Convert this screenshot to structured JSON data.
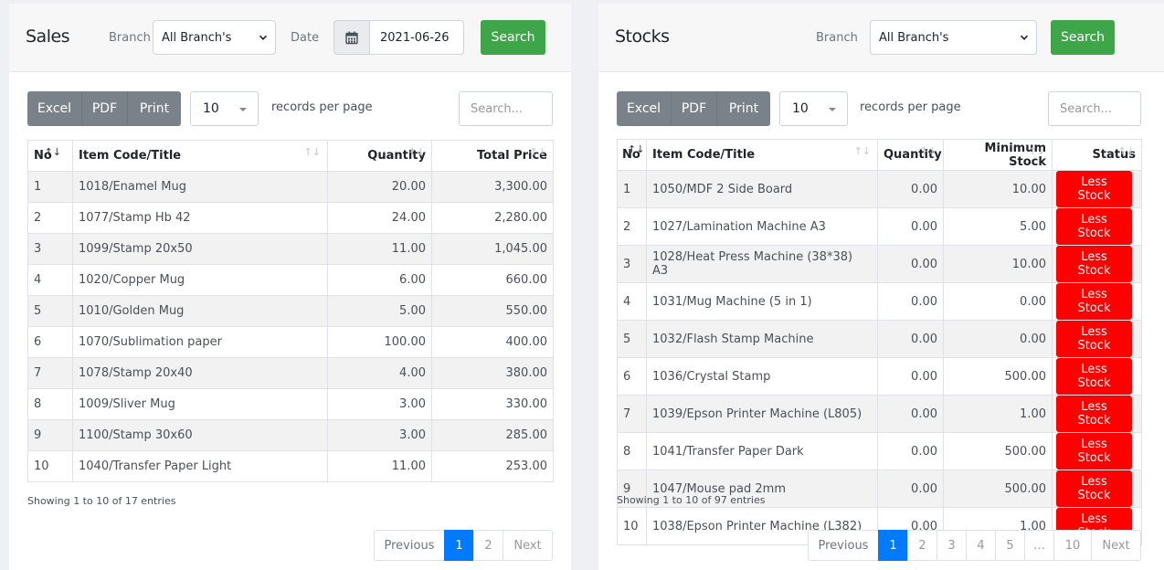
{
  "sales": {
    "title": "Sales",
    "branch_label": "Branch",
    "branch_value": "All Branch's",
    "date_label": "Date",
    "date_value": "2021-06-26",
    "search_button": "Search",
    "export_buttons": [
      "Excel",
      "PDF",
      "Print"
    ],
    "page_length": "10",
    "records_per_page": "records per page",
    "search_placeholder": "Search...",
    "columns": [
      "No",
      "Item Code/Title",
      "Quantity",
      "Total Price"
    ],
    "rows": [
      [
        "1",
        "1018/Enamel Mug",
        "20.00",
        "3,300.00"
      ],
      [
        "2",
        "1077/Stamp Hb 42",
        "24.00",
        "2,280.00"
      ],
      [
        "3",
        "1099/Stamp 20x50",
        "11.00",
        "1,045.00"
      ],
      [
        "4",
        "1020/Copper Mug",
        "6.00",
        "660.00"
      ],
      [
        "5",
        "1010/Golden Mug",
        "5.00",
        "550.00"
      ],
      [
        "6",
        "1070/Sublimation paper",
        "100.00",
        "400.00"
      ],
      [
        "7",
        "1078/Stamp 20x40",
        "4.00",
        "380.00"
      ],
      [
        "8",
        "1009/Sliver Mug",
        "3.00",
        "330.00"
      ],
      [
        "9",
        "1100/Stamp 30x60",
        "3.00",
        "285.00"
      ],
      [
        "10",
        "1040/Transfer Paper Light",
        "11.00",
        "253.00"
      ]
    ],
    "info": "Showing 1 to 10 of 17 entries",
    "pagination": [
      "Previous",
      "1",
      "2",
      "Next"
    ],
    "active_page": "1"
  },
  "stocks": {
    "title": "Stocks",
    "branch_label": "Branch",
    "branch_value": "All Branch's",
    "search_button": "Search",
    "export_buttons": [
      "Excel",
      "PDF",
      "Print"
    ],
    "page_length": "10",
    "records_per_page": "records per page",
    "search_placeholder": "Search...",
    "columns": [
      "No",
      "Item Code/Title",
      "Quantity",
      "Minimum Stock",
      "Status"
    ],
    "rows": [
      [
        "1",
        "1050/MDF 2 Side Board",
        "0.00",
        "10.00",
        "Less Stock"
      ],
      [
        "2",
        "1027/Lamination Machine A3",
        "0.00",
        "5.00",
        "Less Stock"
      ],
      [
        "3",
        "1028/Heat Press Machine (38*38) A3",
        "0.00",
        "10.00",
        "Less Stock"
      ],
      [
        "4",
        "1031/Mug Machine (5 in 1)",
        "0.00",
        "0.00",
        "Less Stock"
      ],
      [
        "5",
        "1032/Flash Stamp Machine",
        "0.00",
        "0.00",
        "Less Stock"
      ],
      [
        "6",
        "1036/Crystal Stamp",
        "0.00",
        "500.00",
        "Less Stock"
      ],
      [
        "7",
        "1039/Epson Printer Machine (L805)",
        "0.00",
        "1.00",
        "Less Stock"
      ],
      [
        "8",
        "1041/Transfer Paper Dark",
        "0.00",
        "500.00",
        "Less Stock"
      ],
      [
        "9",
        "1047/Mouse pad 2mm",
        "0.00",
        "500.00",
        "Less Stock"
      ],
      [
        "10",
        "1038/Epson Printer Machine (L382)",
        "0.00",
        "1.00",
        "Less Stock"
      ]
    ],
    "info": "Showing 1 to 10 of 97 entries",
    "pagination": [
      "Previous",
      "1",
      "2",
      "3",
      "4",
      "5",
      "…",
      "10",
      "Next"
    ],
    "active_page": "1"
  },
  "colors": {
    "search_button": "#3ea648",
    "export_button": "#7a8289",
    "less_stock_badge": "#ff0000",
    "active_page": "#007bff"
  },
  "icons": {
    "date_addon": "calendar-icon",
    "sort": "sort-arrows-icon"
  }
}
